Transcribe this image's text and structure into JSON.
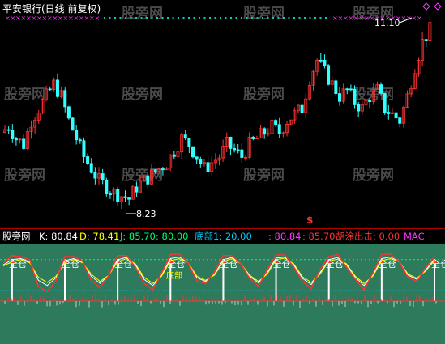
{
  "watermark": "股旁网",
  "main_panel": {
    "title": "平安银行(日线 前复权)",
    "price_high_label": "11.10",
    "price_low_label": "8.23",
    "signal_glyph": "$"
  },
  "indicator_panel": {
    "site_label": "股旁网",
    "readouts": [
      {
        "key": "k",
        "text": "K: 80.84",
        "color": "#ffffff"
      },
      {
        "key": "d",
        "text": "D: 78.41",
        "color": "#ffff00"
      },
      {
        "key": "j",
        "text": "J: 85.70",
        "color": "#00ff66"
      },
      {
        "key": "eighty",
        "text": ": 80.00",
        "color": "#00ff66"
      },
      {
        "key": "bottom",
        "text": "底部1: 20.00",
        "color": "#00ccff"
      },
      {
        "key": "v1",
        "text": ": 80.84",
        "color": "#ff33ff"
      },
      {
        "key": "v2",
        "text": ": 85.70",
        "color": "#ff3333"
      },
      {
        "key": "hutu",
        "text": "胡涂出击: 0.00",
        "color": "#ff3333"
      },
      {
        "key": "mac",
        "text": "MAC",
        "color": "#ff33ff"
      }
    ],
    "signal_label": "全仓",
    "extra_label": "底部"
  },
  "chart_data": [
    {
      "type": "candlestick",
      "title": "平安银行(日线 前复权)",
      "annotations": [
        {
          "label": "11.10",
          "marks": "high"
        },
        {
          "label": "8.23",
          "marks": "low"
        }
      ],
      "close": [
        9.4,
        9.5,
        9.3,
        9.2,
        9.6,
        9.8,
        10.0,
        10.2,
        10.0,
        9.6,
        9.3,
        9.0,
        8.8,
        8.6,
        8.5,
        8.4,
        8.35,
        8.3,
        8.5,
        8.6,
        8.7,
        8.8,
        8.9,
        9.1,
        9.3,
        9.2,
        9.0,
        8.8,
        8.9,
        9.0,
        9.2,
        9.1,
        9.0,
        9.2,
        9.3,
        9.4,
        9.5,
        9.4,
        9.6,
        9.7,
        9.8,
        10.3,
        10.6,
        10.4,
        10.2,
        10.0,
        10.1,
        9.9,
        9.8,
        10.0,
        10.1,
        9.8,
        9.7,
        9.6,
        10.0,
        10.5,
        10.9,
        11.1
      ],
      "high": 11.1,
      "low": 8.23,
      "ylim": [
        8.0,
        11.3
      ]
    },
    {
      "type": "line",
      "title": "KDJ",
      "series": [
        {
          "name": "K",
          "values": [
            70,
            80,
            82,
            76,
            40,
            30,
            45,
            78,
            82,
            75,
            48,
            34,
            50,
            80,
            84,
            70,
            42,
            30,
            50,
            82,
            85,
            74,
            45,
            38,
            52,
            80,
            84,
            72,
            48,
            35,
            55,
            83,
            85,
            70,
            44,
            32,
            55,
            80,
            84,
            70,
            46,
            30,
            50,
            82,
            85,
            76,
            50,
            42,
            60,
            80.84
          ]
        },
        {
          "name": "D",
          "values": [
            68,
            76,
            80,
            74,
            46,
            36,
            48,
            74,
            80,
            74,
            52,
            38,
            50,
            76,
            82,
            72,
            46,
            34,
            48,
            78,
            82,
            74,
            48,
            40,
            50,
            76,
            82,
            72,
            50,
            38,
            52,
            80,
            83,
            72,
            47,
            36,
            52,
            77,
            81,
            72,
            48,
            34,
            48,
            78,
            82,
            76,
            52,
            44,
            58,
            78.41
          ]
        },
        {
          "name": "J",
          "values": [
            74,
            88,
            86,
            80,
            28,
            18,
            40,
            86,
            86,
            77,
            40,
            26,
            50,
            88,
            88,
            66,
            34,
            22,
            54,
            90,
            91,
            74,
            39,
            34,
            56,
            88,
            88,
            72,
            44,
            29,
            61,
            89,
            89,
            66,
            38,
            24,
            61,
            86,
            90,
            66,
            42,
            22,
            54,
            90,
            91,
            76,
            46,
            38,
            64,
            85.7
          ]
        }
      ],
      "ylim": [
        0,
        100
      ]
    }
  ]
}
